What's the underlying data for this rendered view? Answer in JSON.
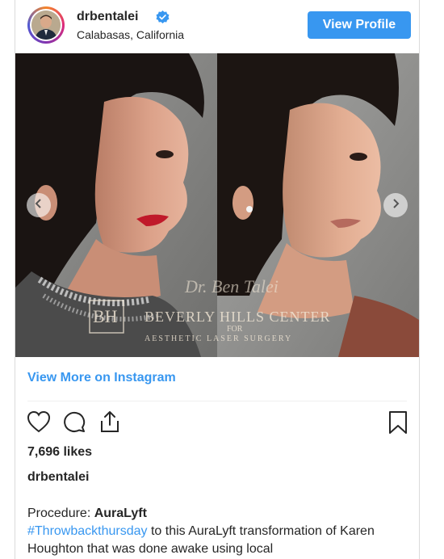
{
  "header": {
    "username": "drbentalei",
    "location": "Calabasas, California",
    "view_profile_label": "View Profile"
  },
  "media": {
    "watermark_line1": "BEVERLY HILLS CENTER",
    "watermark_line2": "FOR",
    "watermark_line3": "AESTHETIC LASER SURGERY",
    "watermark_logo": "BH",
    "signature": "Dr. Ben Talei"
  },
  "view_more_label": "View More on Instagram",
  "likes": "7,696 likes",
  "post_user": "drbentalei",
  "caption": {
    "procedure_label": "Procedure: ",
    "procedure_name": "AuraLyft",
    "hashtag": "#Throwbackthursday",
    "text": " to this AuraLyft transformation of Karen Houghton that was done awake using local"
  },
  "colors": {
    "accent": "#3897f0",
    "text": "#262626",
    "border": "#dbdbdb"
  },
  "icons": [
    "verified-badge-icon",
    "chevron-left-icon",
    "chevron-right-icon",
    "heart-icon",
    "comment-icon",
    "share-icon",
    "bookmark-icon"
  ]
}
